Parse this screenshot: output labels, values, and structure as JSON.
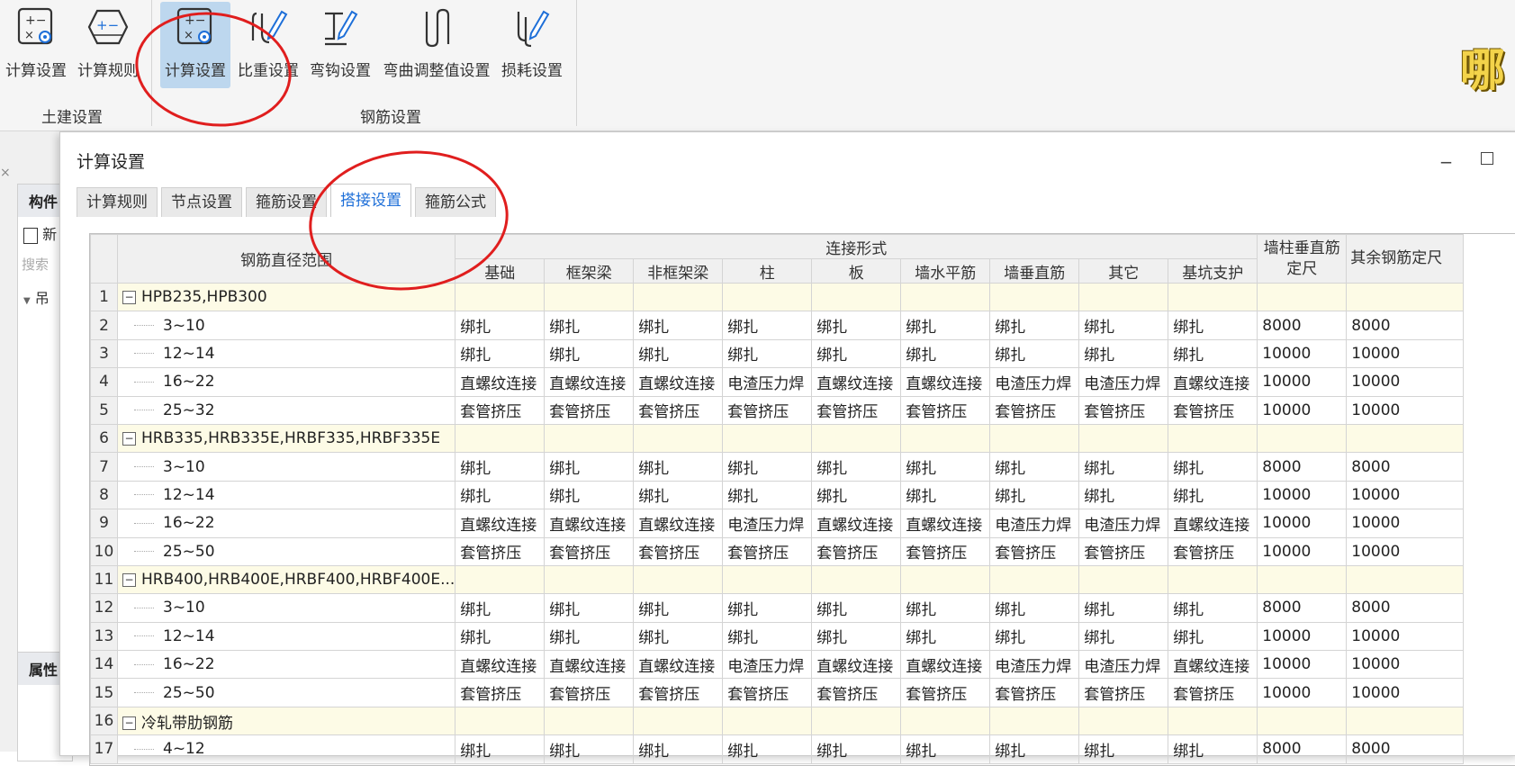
{
  "ribbon": {
    "groups": [
      {
        "label": "土建设置",
        "buttons": [
          {
            "label": "计算设置",
            "icon": "calc-settings-icon"
          },
          {
            "label": "计算规则",
            "icon": "calc-rules-icon"
          }
        ]
      },
      {
        "label": "钢筋设置",
        "buttons": [
          {
            "label": "计算设置",
            "icon": "calc-settings-icon",
            "active": true
          },
          {
            "label": "比重设置",
            "icon": "density-settings-icon"
          },
          {
            "label": "弯钩设置",
            "icon": "hook-settings-icon"
          },
          {
            "label": "弯曲调整值设置",
            "icon": "bend-adjust-icon"
          },
          {
            "label": "损耗设置",
            "icon": "loss-settings-icon"
          }
        ]
      }
    ],
    "overlay_char": "哪"
  },
  "left_panel": {
    "top_header": "构件",
    "new_label": "新",
    "search_placeholder": "搜索",
    "tree_item": "吊",
    "bottom_header": "属性"
  },
  "dialog": {
    "title": "计算设置",
    "tabs": [
      "计算规则",
      "节点设置",
      "箍筋设置",
      "搭接设置",
      "箍筋公式"
    ],
    "active_tab": 3,
    "table": {
      "diameter_header": "钢筋直径范围",
      "connection_header": "连接形式",
      "connection_columns": [
        "基础",
        "框架梁",
        "非框架梁",
        "柱",
        "板",
        "墙水平筋",
        "墙垂直筋",
        "其它",
        "基坑支护"
      ],
      "extra_columns": [
        "墙柱垂直筋定尺",
        "其余钢筋定尺"
      ],
      "rows": [
        {
          "n": "1",
          "type": "group",
          "label": "HPB235,HPB300"
        },
        {
          "n": "2",
          "type": "item",
          "label": "3~10",
          "cells": [
            "绑扎",
            "绑扎",
            "绑扎",
            "绑扎",
            "绑扎",
            "绑扎",
            "绑扎",
            "绑扎",
            "绑扎",
            "8000",
            "8000"
          ]
        },
        {
          "n": "3",
          "type": "item",
          "label": "12~14",
          "cells": [
            "绑扎",
            "绑扎",
            "绑扎",
            "绑扎",
            "绑扎",
            "绑扎",
            "绑扎",
            "绑扎",
            "绑扎",
            "10000",
            "10000"
          ]
        },
        {
          "n": "4",
          "type": "item",
          "label": "16~22",
          "cells": [
            "直螺纹连接",
            "直螺纹连接",
            "直螺纹连接",
            "电渣压力焊",
            "直螺纹连接",
            "直螺纹连接",
            "电渣压力焊",
            "电渣压力焊",
            "直螺纹连接",
            "10000",
            "10000"
          ]
        },
        {
          "n": "5",
          "type": "item",
          "label": "25~32",
          "cells": [
            "套管挤压",
            "套管挤压",
            "套管挤压",
            "套管挤压",
            "套管挤压",
            "套管挤压",
            "套管挤压",
            "套管挤压",
            "套管挤压",
            "10000",
            "10000"
          ]
        },
        {
          "n": "6",
          "type": "group",
          "label": "HRB335,HRB335E,HRBF335,HRBF335E"
        },
        {
          "n": "7",
          "type": "item",
          "label": "3~10",
          "cells": [
            "绑扎",
            "绑扎",
            "绑扎",
            "绑扎",
            "绑扎",
            "绑扎",
            "绑扎",
            "绑扎",
            "绑扎",
            "8000",
            "8000"
          ]
        },
        {
          "n": "8",
          "type": "item",
          "label": "12~14",
          "cells": [
            "绑扎",
            "绑扎",
            "绑扎",
            "绑扎",
            "绑扎",
            "绑扎",
            "绑扎",
            "绑扎",
            "绑扎",
            "10000",
            "10000"
          ]
        },
        {
          "n": "9",
          "type": "item",
          "label": "16~22",
          "cells": [
            "直螺纹连接",
            "直螺纹连接",
            "直螺纹连接",
            "电渣压力焊",
            "直螺纹连接",
            "直螺纹连接",
            "电渣压力焊",
            "电渣压力焊",
            "直螺纹连接",
            "10000",
            "10000"
          ]
        },
        {
          "n": "10",
          "type": "item",
          "label": "25~50",
          "cells": [
            "套管挤压",
            "套管挤压",
            "套管挤压",
            "套管挤压",
            "套管挤压",
            "套管挤压",
            "套管挤压",
            "套管挤压",
            "套管挤压",
            "10000",
            "10000"
          ]
        },
        {
          "n": "11",
          "type": "group",
          "label": "HRB400,HRB400E,HRBF400,HRBF400E..."
        },
        {
          "n": "12",
          "type": "item",
          "label": "3~10",
          "cells": [
            "绑扎",
            "绑扎",
            "绑扎",
            "绑扎",
            "绑扎",
            "绑扎",
            "绑扎",
            "绑扎",
            "绑扎",
            "8000",
            "8000"
          ]
        },
        {
          "n": "13",
          "type": "item",
          "label": "12~14",
          "cells": [
            "绑扎",
            "绑扎",
            "绑扎",
            "绑扎",
            "绑扎",
            "绑扎",
            "绑扎",
            "绑扎",
            "绑扎",
            "10000",
            "10000"
          ]
        },
        {
          "n": "14",
          "type": "item",
          "label": "16~22",
          "cells": [
            "直螺纹连接",
            "直螺纹连接",
            "直螺纹连接",
            "电渣压力焊",
            "直螺纹连接",
            "直螺纹连接",
            "电渣压力焊",
            "电渣压力焊",
            "直螺纹连接",
            "10000",
            "10000"
          ]
        },
        {
          "n": "15",
          "type": "item",
          "label": "25~50",
          "cells": [
            "套管挤压",
            "套管挤压",
            "套管挤压",
            "套管挤压",
            "套管挤压",
            "套管挤压",
            "套管挤压",
            "套管挤压",
            "套管挤压",
            "10000",
            "10000"
          ]
        },
        {
          "n": "16",
          "type": "group",
          "label": "冷轧带肋钢筋"
        },
        {
          "n": "17",
          "type": "item",
          "label": "4~12",
          "cells": [
            "绑扎",
            "绑扎",
            "绑扎",
            "绑扎",
            "绑扎",
            "绑扎",
            "绑扎",
            "绑扎",
            "绑扎",
            "8000",
            "8000"
          ]
        }
      ]
    }
  },
  "colors": {
    "accent": "#1e6fd8",
    "active_button_bg": "#bdd7ee",
    "group_row_bg": "#fdfbe6",
    "annotation_red": "#e01e1e"
  }
}
